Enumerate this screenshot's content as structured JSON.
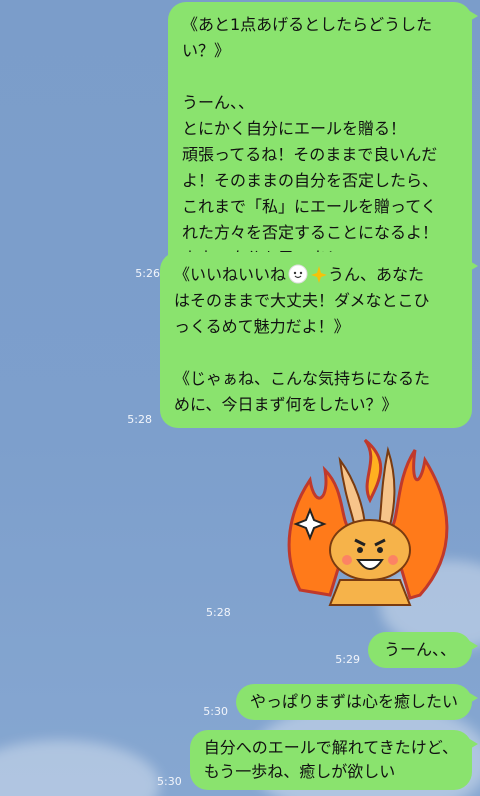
{
  "messages": [
    {
      "time": "5:26",
      "text": "《あと1点あげるとしたらどうした\nい？》\n\nうーん、、\nとにかく自分にエールを贈る！\n頑張ってるね！そのままで良いんだ\nよ！そのままの自分を否定したら、\nこれまで「私」にエールを贈ってく\nれた方々を否定することになるよ！\n本来の自分を思い出して！"
    },
    {
      "time": "5:28",
      "text_a": "《いいねいいね",
      "text_b": "うん、あなた\nはそのままで大丈夫！ダメなとこひ\nっくるめて魅力だよ！》\n\n《じゃぁね、こんな気持ちになるた\nめに、今日まず何をしたい？》"
    },
    {
      "time": "5:28",
      "sticker": "rabbit-fire-sticker"
    },
    {
      "time": "5:29",
      "text": "うーん、、"
    },
    {
      "time": "5:30",
      "text": "やっぱりまずは心を癒したい"
    },
    {
      "time": "5:30",
      "text": "自分へのエールで解れてきたけど、\nもう一歩ね、癒しが欲しい"
    }
  ],
  "colors": {
    "bubble": "#8ae36e",
    "background": "#7b9dca"
  }
}
